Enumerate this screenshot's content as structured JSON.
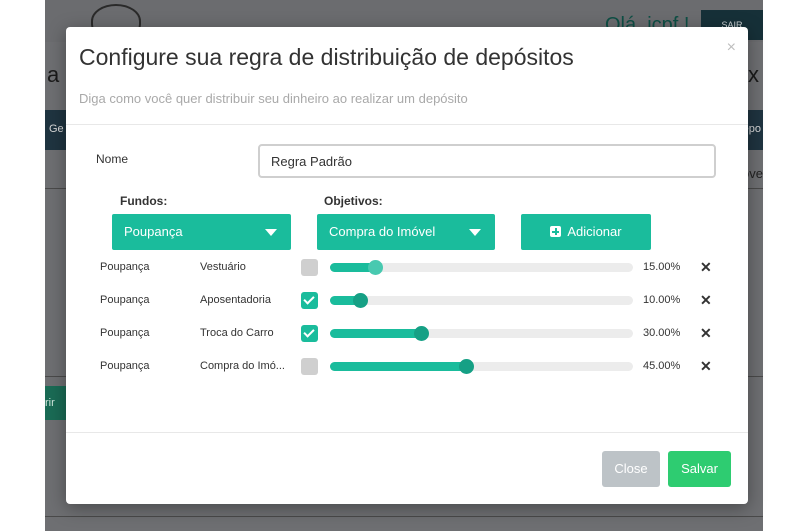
{
  "background": {
    "greeting": "Olá, jcpf !",
    "logout_label": "SAIR",
    "nav_left": "Ge",
    "nav_right": "epo",
    "side_left": "a",
    "side_right": "x",
    "overview_fragment": "ove",
    "green_fragment": "rir"
  },
  "modal": {
    "title": "Configure sua regra de distribuição de depósitos",
    "subtitle": "Diga como você quer distribuir seu dinheiro ao realizar um depósito",
    "close_symbol": "×",
    "name_label": "Nome",
    "name_value": "Regra Padrão",
    "fundos_label": "Fundos:",
    "fundos_selected": "Poupança",
    "objetivos_label": "Objetivos:",
    "objetivos_selected": "Compra do Imóvel",
    "add_label": "Adicionar",
    "rules": [
      {
        "fundo": "Poupança",
        "objetivo": "Vestuário",
        "checked": false,
        "percent": 15,
        "percent_label": "15.00%",
        "delete": "✕"
      },
      {
        "fundo": "Poupança",
        "objetivo": "Aposentadoria",
        "checked": true,
        "percent": 10,
        "percent_label": "10.00%",
        "delete": "✕"
      },
      {
        "fundo": "Poupança",
        "objetivo": "Troca do Carro",
        "checked": true,
        "percent": 30,
        "percent_label": "30.00%",
        "delete": "✕"
      },
      {
        "fundo": "Poupança",
        "objetivo": "Compra do Imó...",
        "checked": false,
        "percent": 45,
        "percent_label": "45.00%",
        "delete": "✕"
      }
    ],
    "close_label": "Close",
    "save_label": "Salvar"
  },
  "colors": {
    "accent": "#1abc9c",
    "save": "#2ecc71",
    "close": "#bdc3c7"
  }
}
